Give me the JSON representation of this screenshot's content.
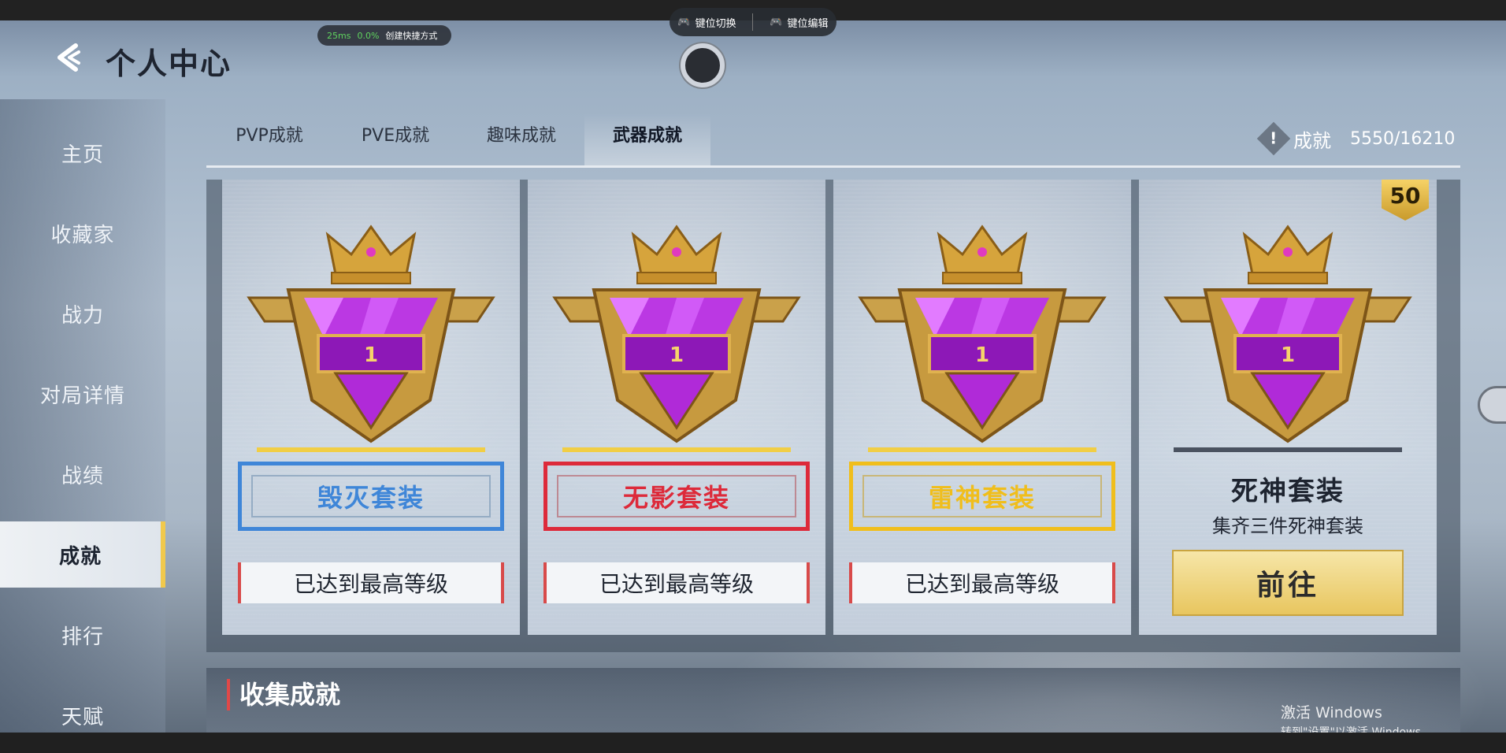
{
  "header": {
    "title": "个人中心"
  },
  "status_pill": {
    "ping": "25ms",
    "loss": "0.0%",
    "shortcut": "创建快捷方式"
  },
  "key_pill": {
    "switch": "键位切换",
    "edit": "键位编辑"
  },
  "sidebar": {
    "items": [
      {
        "label": "主页",
        "active": false
      },
      {
        "label": "收藏家",
        "active": false
      },
      {
        "label": "战力",
        "active": false
      },
      {
        "label": "对局详情",
        "active": false
      },
      {
        "label": "战绩",
        "active": false
      },
      {
        "label": "成就",
        "active": true
      },
      {
        "label": "排行",
        "active": false
      },
      {
        "label": "天赋",
        "active": false
      }
    ]
  },
  "tabs": [
    {
      "label": "PVP成就",
      "active": false
    },
    {
      "label": "PVE成就",
      "active": false
    },
    {
      "label": "趣味成就",
      "active": false
    },
    {
      "label": "武器成就",
      "active": true
    }
  ],
  "achievement_summary": {
    "label": "成就",
    "value": "5550/16210"
  },
  "cards": [
    {
      "name": "毁灭套装",
      "color": "#3f86d8",
      "status": "已达到最高等级",
      "rank": "1"
    },
    {
      "name": "无影套装",
      "color": "#dd2a3a",
      "status": "已达到最高等级",
      "rank": "1"
    },
    {
      "name": "雷神套装",
      "color": "#f0be1c",
      "status": "已达到最高等级",
      "rank": "1"
    },
    {
      "name": "死神套装",
      "desc": "集齐三件死神套装",
      "button": "前往",
      "level": "50",
      "rank": "1"
    }
  ],
  "collect": {
    "title": "收集成就"
  },
  "watermark": {
    "line1": "激活 Windows",
    "line2": "转到\"设置\"以激活 Windows。"
  },
  "colors": {
    "accent_gold": "#f1c94d",
    "diamond_purple": "#a51fd0",
    "crown_gold": "#d6a43c"
  }
}
